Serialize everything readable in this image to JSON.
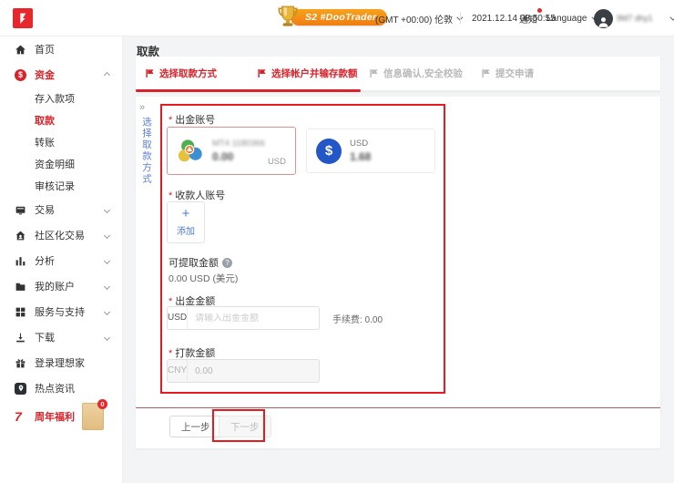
{
  "colors": {
    "accent_red": "#d9232a",
    "annotation_red": "#e8191f",
    "link_blue": "#4a7bd8",
    "badge_orange": "#f08019",
    "dollar_blue": "#2356c7"
  },
  "header": {
    "badge_label": "S2 #DooTrader",
    "timezone": "(GMT +00:00) 伦敦",
    "datetime": "2021.12.14 08:50:55",
    "notification_label": "通知",
    "language_label": "Language",
    "username": "9M7 dhy1"
  },
  "sidebar": {
    "items": [
      {
        "label": "首页"
      },
      {
        "label": "资金",
        "icon_text": "$"
      },
      {
        "label": "存入款项"
      },
      {
        "label": "取款"
      },
      {
        "label": "转账"
      },
      {
        "label": "资金明细"
      },
      {
        "label": "审核记录"
      },
      {
        "label": "交易"
      },
      {
        "label": "社区化交易"
      },
      {
        "label": "分析"
      },
      {
        "label": "我的账户"
      },
      {
        "label": "服务与支持"
      },
      {
        "label": "下载"
      },
      {
        "label": "登录理想家"
      },
      {
        "label": "热点资讯"
      },
      {
        "label": "周年福利",
        "icon_text": "7",
        "badge": "0"
      }
    ]
  },
  "page": {
    "title": "取款",
    "steps": [
      {
        "label": "选择取款方式"
      },
      {
        "label": "选择帐户并输存款额"
      },
      {
        "label": "信息确认,安全校验"
      },
      {
        "label": "提交申请"
      }
    ],
    "expander": "»",
    "collapse_hint": "选择取款方式",
    "required_marker": "*",
    "form": {
      "source_label": "出金账号",
      "mt4_card": {
        "title": "MT4 1180366",
        "value": "0.00",
        "currency": "USD"
      },
      "usd_card": {
        "symbol": "$",
        "title": "USD",
        "value": "1.68"
      },
      "payee_label": "收款人账号",
      "add_plus": "+",
      "add_label": "添加",
      "available_label": "可提取金额",
      "available_help": "?",
      "available_value": "0.00 USD (美元)",
      "amount_label": "出金金额",
      "amount_currency": "USD",
      "amount_placeholder": "请输入出金金额",
      "fee_text": "手续费: 0.00",
      "payout_label": "打款金额",
      "payout_currency": "CNY",
      "payout_value": "0.00"
    },
    "buttons": {
      "prev": "上一步",
      "next": "下一步"
    }
  }
}
